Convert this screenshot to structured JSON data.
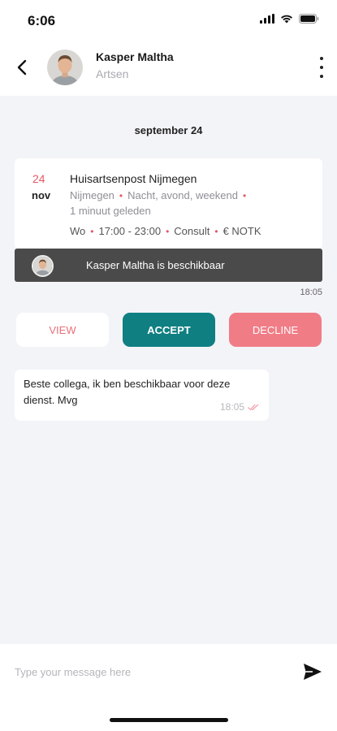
{
  "status_bar": {
    "time": "6:06",
    "icons": [
      "signal-icon",
      "wifi-icon",
      "battery-icon"
    ]
  },
  "header": {
    "name": "Kasper Maltha",
    "subtitle": "Artsen",
    "icons": [
      "back-arrow-icon",
      "avatar",
      "more-vertical-icon"
    ]
  },
  "date_separator": "september 24",
  "shift_card": {
    "day": "24",
    "month": "nov",
    "title": "Huisartsenpost Nijmegen",
    "location": "Nijmegen",
    "shift_type": "Nacht, avond, weekend",
    "posted": "1 minuut geleden",
    "weekday": "Wo",
    "hours": "17:00 - 23:00",
    "kind": "Consult",
    "rate": "€ NOTK"
  },
  "availability": {
    "text": "Kasper Maltha is beschikbaar",
    "time": "18:05"
  },
  "actions": {
    "view": "VIEW",
    "accept": "ACCEPT",
    "decline": "DECLINE"
  },
  "message": {
    "text": "Beste collega, ik ben beschikbaar voor deze dienst. Mvg",
    "time": "18:05",
    "status_icon": "double-check-icon"
  },
  "composer": {
    "placeholder": "Type your message here",
    "send_icon": "send-icon"
  },
  "colors": {
    "accent_red": "#e45a64",
    "accept_teal": "#0f7f82",
    "decline_pink": "#f07c86",
    "banner_dark": "#4a4a4a",
    "background": "#f3f4f8"
  }
}
